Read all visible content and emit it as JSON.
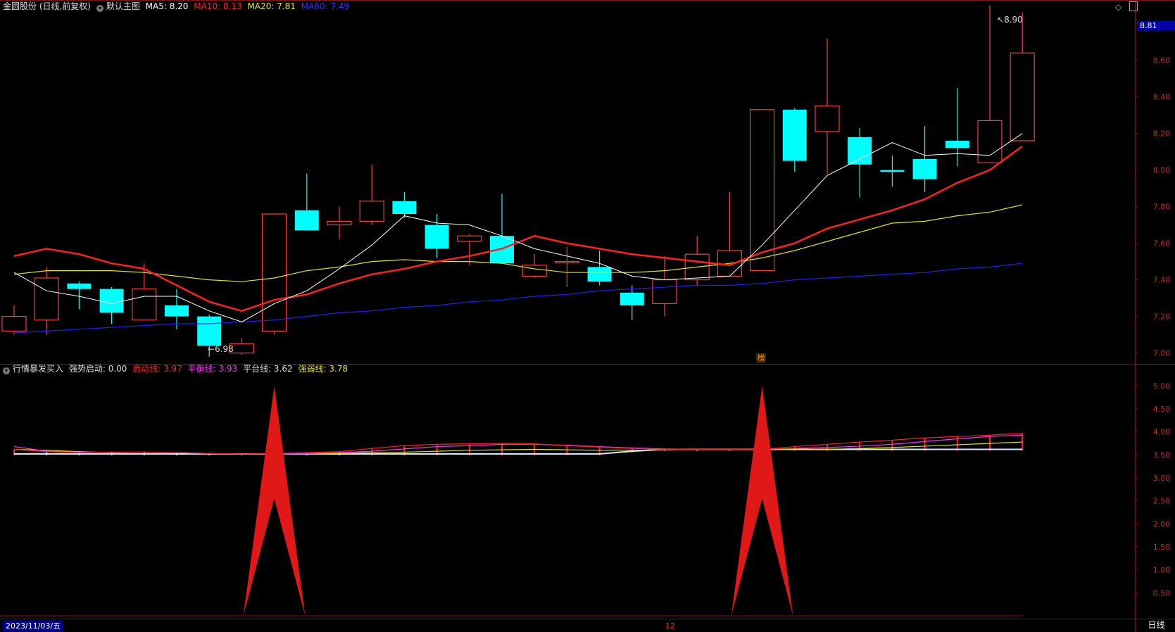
{
  "main_header": {
    "stock": "金圆股份 (日线,前复权)",
    "template": "默认主图",
    "ma5": "MA5: 8.20",
    "ma10": "MA10: 8.13",
    "ma20": "MA20: 7.81",
    "ma60": "MA60: 7.49"
  },
  "sub_header": {
    "name": "行情暴发买入",
    "qdqd": "强势启动: 0.00",
    "qdx": "启动线: 3.97",
    "phx": "平衡线: 3.93",
    "ptx": "平台线: 3.62",
    "qrx": "强弱线: 3.78"
  },
  "price_tag": "8.81",
  "high_label": "8.90",
  "low_label": "6.98",
  "marker_label": "榜",
  "date_label": "2023/11/03/五",
  "month_label": "12",
  "period_label": "日线",
  "colors": {
    "up": "#ff3b3b",
    "down": "#00ffff",
    "ma5": "#ffffff",
    "ma10": "#ff2020",
    "ma20": "#e6e600",
    "ma60": "#2020ff"
  },
  "chart_data": [
    {
      "type": "candlestick",
      "yticks": [
        "8.80",
        "8.60",
        "8.40",
        "8.20",
        "8.00",
        "7.80",
        "7.60",
        "7.40",
        "7.20",
        "7.00"
      ],
      "ylim": [
        6.96,
        8.86
      ],
      "candles": [
        {
          "o": 7.12,
          "h": 7.26,
          "l": 7.1,
          "c": 7.2
        },
        {
          "o": 7.18,
          "h": 7.47,
          "l": 7.1,
          "c": 7.41
        },
        {
          "o": 7.38,
          "h": 7.39,
          "l": 7.24,
          "c": 7.35
        },
        {
          "o": 7.35,
          "h": 7.36,
          "l": 7.16,
          "c": 7.22
        },
        {
          "o": 7.18,
          "h": 7.49,
          "l": 7.18,
          "c": 7.35
        },
        {
          "o": 7.26,
          "h": 7.35,
          "l": 7.13,
          "c": 7.2
        },
        {
          "o": 7.2,
          "h": 7.21,
          "l": 6.98,
          "c": 7.04
        },
        {
          "o": 7.0,
          "h": 7.08,
          "l": 6.99,
          "c": 7.05
        },
        {
          "o": 7.12,
          "h": 7.76,
          "l": 7.1,
          "c": 7.76
        },
        {
          "o": 7.78,
          "h": 7.98,
          "l": 7.67,
          "c": 7.67
        },
        {
          "o": 7.7,
          "h": 7.8,
          "l": 7.62,
          "c": 7.72
        },
        {
          "o": 7.72,
          "h": 8.03,
          "l": 7.7,
          "c": 7.83
        },
        {
          "o": 7.83,
          "h": 7.88,
          "l": 7.74,
          "c": 7.76
        },
        {
          "o": 7.7,
          "h": 7.76,
          "l": 7.52,
          "c": 7.57
        },
        {
          "o": 7.61,
          "h": 7.65,
          "l": 7.48,
          "c": 7.64
        },
        {
          "o": 7.64,
          "h": 7.87,
          "l": 7.49,
          "c": 7.49
        },
        {
          "o": 7.42,
          "h": 7.54,
          "l": 7.41,
          "c": 7.48
        },
        {
          "o": 7.5,
          "h": 7.58,
          "l": 7.36,
          "c": 7.5
        },
        {
          "o": 7.47,
          "h": 7.56,
          "l": 7.37,
          "c": 7.39
        },
        {
          "o": 7.33,
          "h": 7.37,
          "l": 7.18,
          "c": 7.26
        },
        {
          "o": 7.27,
          "h": 7.53,
          "l": 7.2,
          "c": 7.4
        },
        {
          "o": 7.4,
          "h": 7.64,
          "l": 7.37,
          "c": 7.54
        },
        {
          "o": 7.42,
          "h": 7.88,
          "l": 7.42,
          "c": 7.56
        },
        {
          "o": 7.45,
          "h": 8.33,
          "l": 7.45,
          "c": 8.33
        },
        {
          "o": 8.33,
          "h": 8.34,
          "l": 7.99,
          "c": 8.05
        },
        {
          "o": 8.21,
          "h": 8.72,
          "l": 7.98,
          "c": 8.35
        },
        {
          "o": 8.18,
          "h": 8.23,
          "l": 7.85,
          "c": 8.03
        },
        {
          "o": 8.0,
          "h": 8.08,
          "l": 7.91,
          "c": 7.99
        },
        {
          "o": 8.06,
          "h": 8.24,
          "l": 7.88,
          "c": 7.95
        },
        {
          "o": 8.16,
          "h": 8.45,
          "l": 8.02,
          "c": 8.12
        },
        {
          "o": 8.04,
          "h": 8.9,
          "l": 8.04,
          "c": 8.27
        },
        {
          "o": 8.16,
          "h": 8.86,
          "l": 8.16,
          "c": 8.64
        }
      ],
      "ma": [
        {
          "name": "MA5",
          "values": [
            7.44,
            7.34,
            7.31,
            7.27,
            7.31,
            7.31,
            7.23,
            7.17,
            7.27,
            7.34,
            7.46,
            7.59,
            7.75,
            7.71,
            7.7,
            7.64,
            7.57,
            7.53,
            7.49,
            7.42,
            7.4,
            7.41,
            7.42,
            7.59,
            7.78,
            7.97,
            8.06,
            8.15,
            8.08,
            8.09,
            8.08,
            8.2
          ]
        },
        {
          "name": "MA10",
          "values": [
            7.53,
            7.57,
            7.54,
            7.49,
            7.46,
            7.37,
            7.28,
            7.23,
            7.29,
            7.32,
            7.38,
            7.43,
            7.46,
            7.5,
            7.53,
            7.57,
            7.64,
            7.6,
            7.57,
            7.54,
            7.52,
            7.5,
            7.48,
            7.55,
            7.6,
            7.68,
            7.73,
            7.78,
            7.84,
            7.93,
            8.0,
            8.13
          ]
        },
        {
          "name": "MA20",
          "values": [
            7.43,
            7.45,
            7.45,
            7.45,
            7.44,
            7.42,
            7.4,
            7.39,
            7.41,
            7.45,
            7.47,
            7.5,
            7.51,
            7.5,
            7.5,
            7.49,
            7.46,
            7.44,
            7.44,
            7.44,
            7.45,
            7.47,
            7.49,
            7.52,
            7.56,
            7.61,
            7.66,
            7.71,
            7.72,
            7.75,
            7.77,
            7.81
          ]
        },
        {
          "name": "MA60",
          "values": [
            7.11,
            7.12,
            7.13,
            7.14,
            7.15,
            7.16,
            7.16,
            7.17,
            7.18,
            7.2,
            7.22,
            7.23,
            7.25,
            7.26,
            7.28,
            7.29,
            7.31,
            7.32,
            7.34,
            7.35,
            7.36,
            7.37,
            7.37,
            7.38,
            7.4,
            7.41,
            7.42,
            7.43,
            7.44,
            7.46,
            7.47,
            7.49
          ]
        }
      ]
    },
    {
      "type": "indicator",
      "yticks": [
        "5.00",
        "4.50",
        "4.00",
        "3.50",
        "3.00",
        "2.50",
        "2.00",
        "1.50",
        "1.00",
        "0.50"
      ],
      "ylim": [
        0,
        5.25
      ],
      "signal_spikes": [
        {
          "bar": 8,
          "value": 5.0
        },
        {
          "bar": 23,
          "value": 5.0
        }
      ],
      "series": [
        {
          "name": "启动线",
          "values": [
            3.62,
            3.57,
            3.55,
            3.56,
            3.56,
            3.55,
            3.53,
            3.52,
            3.53,
            3.55,
            3.57,
            3.64,
            3.7,
            3.73,
            3.74,
            3.75,
            3.74,
            3.7,
            3.67,
            3.64,
            3.62,
            3.62,
            3.62,
            3.62,
            3.68,
            3.73,
            3.78,
            3.82,
            3.87,
            3.9,
            3.93,
            3.97
          ]
        },
        {
          "name": "平衡线",
          "values": [
            3.68,
            3.58,
            3.56,
            3.56,
            3.56,
            3.55,
            3.53,
            3.52,
            3.52,
            3.53,
            3.55,
            3.58,
            3.63,
            3.68,
            3.7,
            3.73,
            3.73,
            3.71,
            3.68,
            3.65,
            3.63,
            3.62,
            3.62,
            3.62,
            3.64,
            3.66,
            3.69,
            3.73,
            3.79,
            3.85,
            3.9,
            3.93
          ]
        },
        {
          "name": "平台线",
          "values": [
            3.52,
            3.52,
            3.52,
            3.52,
            3.52,
            3.52,
            3.52,
            3.52,
            3.52,
            3.52,
            3.52,
            3.52,
            3.52,
            3.52,
            3.52,
            3.52,
            3.52,
            3.52,
            3.52,
            3.58,
            3.62,
            3.62,
            3.62,
            3.62,
            3.62,
            3.62,
            3.62,
            3.62,
            3.62,
            3.62,
            3.62,
            3.62
          ]
        },
        {
          "name": "强弱线",
          "values": [
            3.62,
            3.6,
            3.57,
            3.55,
            3.56,
            3.55,
            3.53,
            3.52,
            3.52,
            3.52,
            3.53,
            3.55,
            3.56,
            3.58,
            3.6,
            3.61,
            3.62,
            3.61,
            3.6,
            3.6,
            3.61,
            3.62,
            3.62,
            3.62,
            3.62,
            3.62,
            3.64,
            3.66,
            3.69,
            3.72,
            3.75,
            3.78
          ]
        }
      ]
    }
  ]
}
